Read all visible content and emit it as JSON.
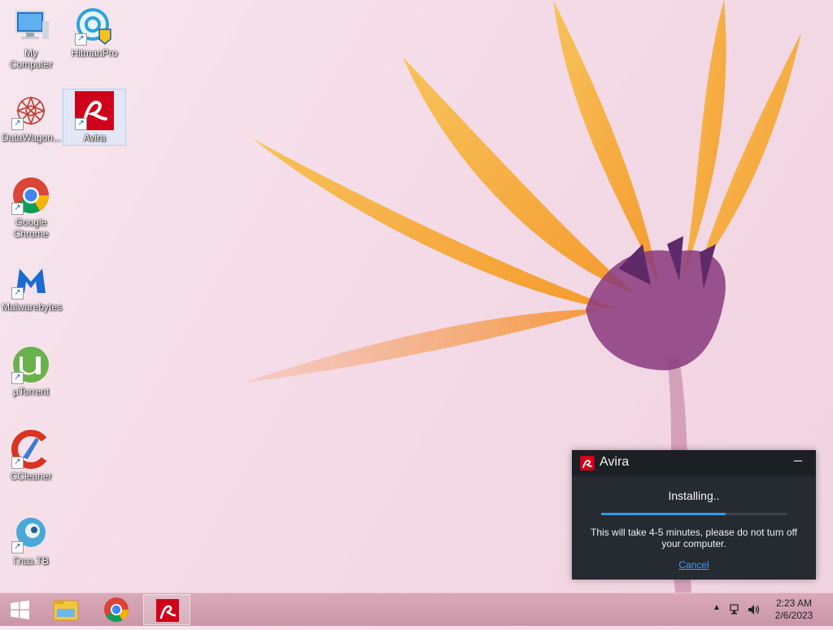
{
  "desktop": {
    "icons": [
      {
        "label": "My Computer"
      },
      {
        "label": "HitmanPro"
      },
      {
        "label": "DataWagon..."
      },
      {
        "label": "Avira"
      },
      {
        "label": "Google Chrome"
      },
      {
        "label": "Malwarebytes"
      },
      {
        "label": "µTorrent"
      },
      {
        "label": "CCleaner"
      },
      {
        "label": "Глаз.ТВ"
      }
    ]
  },
  "installer": {
    "title": "Avira",
    "minimize_label": "–",
    "status": "Installing..",
    "progress": 0.67,
    "message": "This will take 4-5 minutes, please do not turn off your computer.",
    "cancel_label": "Cancel",
    "accent_color": "#2f9ae6",
    "brand_color": "#d0021b"
  },
  "taskbar": {
    "items": [
      {
        "icon": "windows-start-icon"
      },
      {
        "icon": "file-explorer-icon"
      },
      {
        "icon": "chrome-icon"
      },
      {
        "icon": "avira-icon",
        "active": true
      }
    ],
    "tray": {
      "time": "2:23 AM",
      "date": "2/6/2023"
    }
  }
}
